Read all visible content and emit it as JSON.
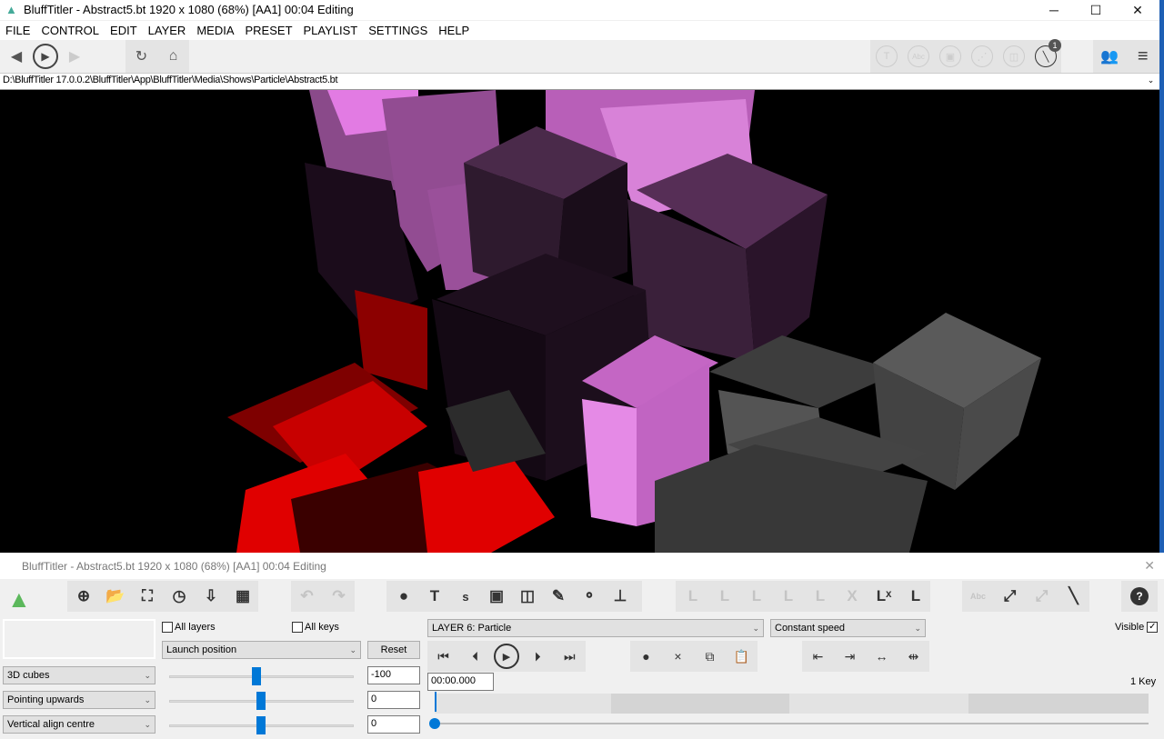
{
  "window": {
    "title": "BluffTitler - Abstract5.bt 1920 x 1080 (68%) [AA1] 00:04 Editing",
    "minimize": "─",
    "maximize": "☐",
    "close": "✕"
  },
  "menu": [
    "FILE",
    "CONTROL",
    "EDIT",
    "LAYER",
    "MEDIA",
    "PRESET",
    "PLAYLIST",
    "SETTINGS",
    "HELP"
  ],
  "toolbar": {
    "left_icons": [
      "back-icon",
      "play-icon",
      "forward-icon",
      "refresh-icon",
      "home-icon"
    ],
    "right_icons": [
      {
        "icon": "text-icon",
        "label": "T"
      },
      {
        "icon": "abc-icon",
        "label": "Abc"
      },
      {
        "icon": "picture-icon",
        "label": "▣"
      },
      {
        "icon": "network-icon",
        "label": "⋰"
      },
      {
        "icon": "cube-icon",
        "label": "◫"
      }
    ],
    "badge_count": "1"
  },
  "path": "D:\\BluffTitler 17.0.0.2\\BluffTitler\\App\\BluffTitler\\Media\\Shows\\Particle\\Abstract5.bt",
  "panel": {
    "title": "BluffTitler - Abstract5.bt 1920 x 1080 (68%) [AA1] 00:04 Editing",
    "all_layers": "All layers",
    "all_keys": "All keys",
    "property": "Launch position",
    "reset": "Reset",
    "dropdowns": [
      "3D cubes",
      "Pointing upwards",
      "Vertical align centre"
    ],
    "values": [
      "-100",
      "0",
      "0"
    ],
    "layer": "LAYER   6: Particle",
    "speed": "Constant speed",
    "visible": "Visible",
    "visible_checked": true,
    "time": "00:00.000",
    "keys": "1 Key",
    "colors": {
      "accent": "#0078d7"
    }
  }
}
